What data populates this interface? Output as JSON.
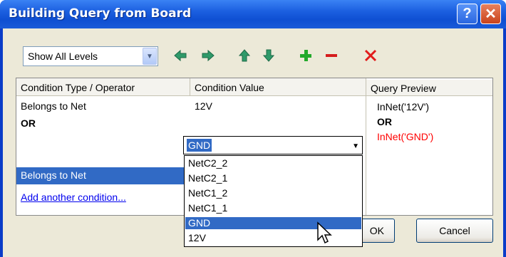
{
  "window": {
    "title": "Building Query from Board",
    "help_label": "?",
    "close_label": "✕"
  },
  "toolbar": {
    "level_select_value": "Show All Levels",
    "icons": [
      "move-left-icon",
      "move-right-icon",
      "move-up-icon",
      "move-down-icon",
      "add-icon",
      "remove-icon",
      "delete-icon"
    ]
  },
  "grid": {
    "headers": {
      "condition_type": "Condition Type / Operator",
      "condition_value": "Condition Value",
      "query_preview": "Query Preview"
    },
    "rows": [
      {
        "type": "Belongs to Net",
        "value": "12V"
      },
      {
        "operator": "OR"
      },
      {
        "type": "Belongs to Net",
        "value": "GND"
      }
    ],
    "add_condition_link": "Add another condition...",
    "preview": [
      "InNet('12V')",
      "OR",
      "InNet('GND')"
    ]
  },
  "dropdown": {
    "current": "GND",
    "options": [
      "NetC2_2",
      "NetC2_1",
      "NetC1_2",
      "NetC1_1",
      "GND",
      "12V"
    ],
    "selected_index": 4
  },
  "buttons": {
    "ok_label": "OK",
    "cancel_label": "Cancel"
  },
  "colors": {
    "title_bar": "#1b5fe0",
    "selection": "#316ac5",
    "preview_highlight": "#ff0000",
    "link": "#0000ee"
  }
}
